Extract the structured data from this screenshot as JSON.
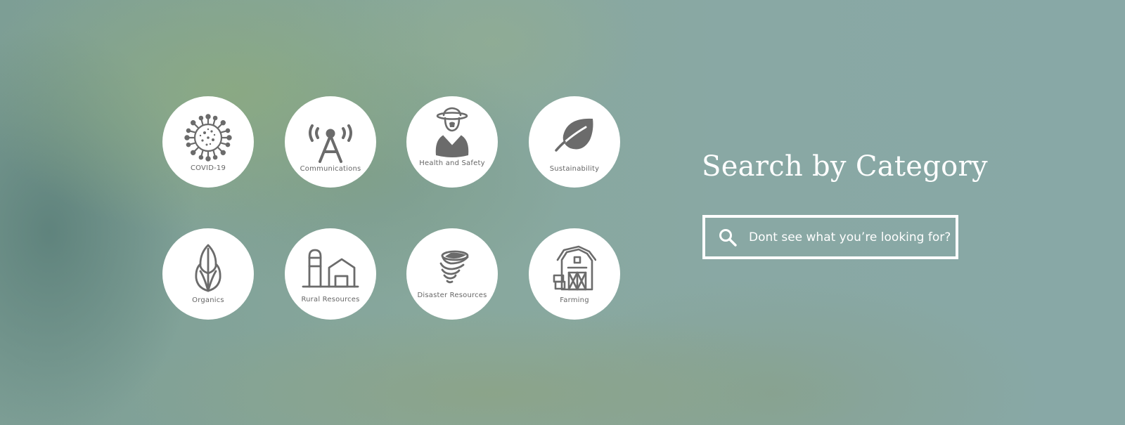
{
  "categories": [
    {
      "label": "COVID-19",
      "icon": "virus-icon"
    },
    {
      "label": "Communications",
      "icon": "radio-tower-icon"
    },
    {
      "label": "Health and Safety",
      "icon": "farmer-icon"
    },
    {
      "label": "Sustainability",
      "icon": "leaf-icon"
    },
    {
      "label": "Organics",
      "icon": "corn-icon"
    },
    {
      "label": "Rural Resources",
      "icon": "silo-barn-icon"
    },
    {
      "label": "Disaster Resources",
      "icon": "tornado-icon"
    },
    {
      "label": "Farming",
      "icon": "barn-icon"
    }
  ],
  "search": {
    "title": "Search by Category",
    "placeholder": "Dont see what you’re looking for?",
    "icon": "search-icon"
  },
  "colors": {
    "icon": "#6b6b6b",
    "tile": "#ffffff",
    "text_light": "#ffffff"
  }
}
